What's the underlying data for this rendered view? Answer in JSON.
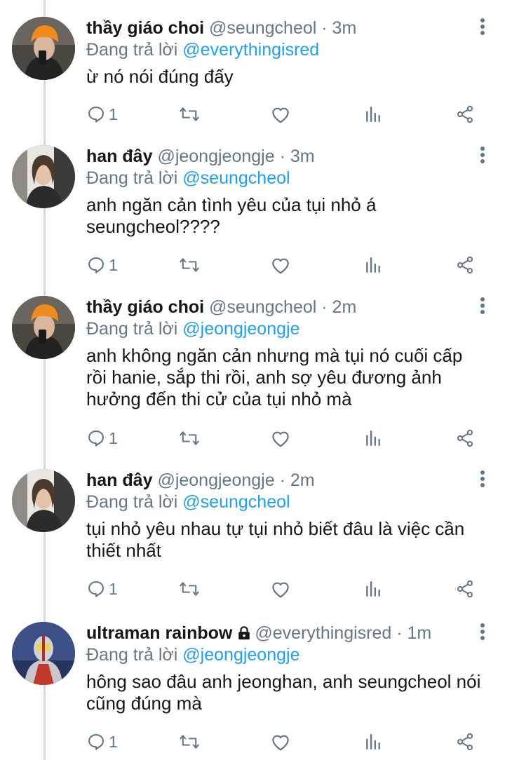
{
  "colors": {
    "accent": "#1da1f2",
    "muted": "#657786",
    "text": "#14171a",
    "thread_line": "#cfd9de"
  },
  "replies": [
    {
      "name": "thầy giáo choi",
      "handle": "@seungcheol",
      "time": "3m",
      "reply_prefix": "Đang trả lời",
      "reply_to": "@everythingisred",
      "text": "ừ nó nói đúng đấy",
      "reply_count": "1",
      "avatar_icon": "orange-beanie-avatar"
    },
    {
      "name": "han đây",
      "handle": "@jeongjeongje",
      "time": "3m",
      "reply_prefix": "Đang trả lời",
      "reply_to": "@seungcheol",
      "text": "anh ngăn cản tình yêu của tụi nhỏ á seungcheol????",
      "reply_count": "1",
      "avatar_icon": "long-hair-avatar"
    },
    {
      "name": "thầy giáo choi",
      "handle": "@seungcheol",
      "time": "2m",
      "reply_prefix": "Đang trả lời",
      "reply_to": "@jeongjeongje",
      "text": "anh không ngăn cản nhưng mà tụi nó cuối cấp rồi hanie, sắp thi rồi, anh sợ yêu đương ảnh hưởng đến thi cử của tụi nhỏ mà",
      "reply_count": "1",
      "avatar_icon": "orange-beanie-avatar"
    },
    {
      "name": "han đây",
      "handle": "@jeongjeongje",
      "time": "2m",
      "reply_prefix": "Đang trả lời",
      "reply_to": "@seungcheol",
      "text": "tụi nhỏ yêu nhau tự tụi nhỏ biết đâu là việc cần thiết nhất",
      "reply_count": "1",
      "avatar_icon": "long-hair-avatar"
    },
    {
      "name": "ultraman rainbow",
      "handle": "@everythingisred",
      "time": "1m",
      "reply_prefix": "Đang trả lời",
      "reply_to": "@jeongjeongje",
      "text": "hông sao đâu anh jeonghan, anh seungcheol nói cũng đúng mà",
      "reply_count": "1",
      "avatar_icon": "ultraman-avatar",
      "locked": true
    }
  ]
}
